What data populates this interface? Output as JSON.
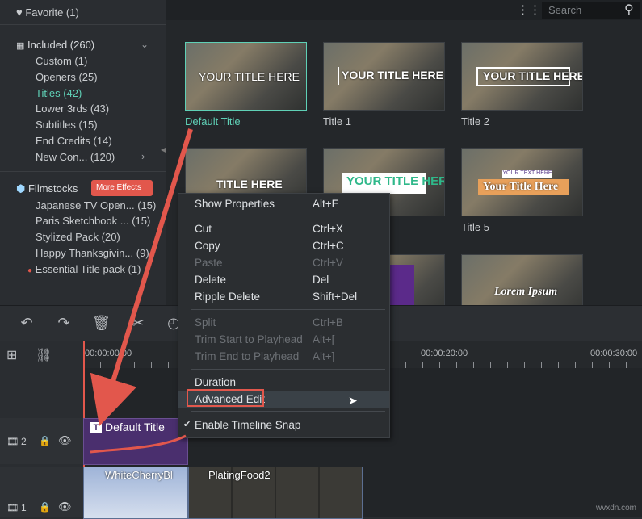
{
  "sidebar": {
    "favorite": "Favorite (1)",
    "included": "Included (260)",
    "included_items": [
      "Custom (1)",
      "Openers (25)",
      "Titles (42)",
      "Lower 3rds (43)",
      "Subtitles (15)",
      "End Credits (14)",
      "New Con... (120)"
    ],
    "filmstocks": "Filmstocks",
    "more_effects": "More Effects",
    "filmstock_items": [
      "Japanese TV Open... (15)",
      "Paris Sketchbook ... (15)",
      "Stylized Pack (20)",
      "Happy Thanksgivin... (9)",
      "Essential Title pack (1)"
    ]
  },
  "search": {
    "placeholder": "Search"
  },
  "gallery": {
    "items": [
      {
        "caption": "Default Title",
        "text": "YOUR TITLE HERE"
      },
      {
        "caption": "Title 1",
        "text": "YOUR TITLE HERE"
      },
      {
        "caption": "Title 2",
        "text": "YOUR TITLE HERE"
      },
      {
        "caption": "",
        "text": "TITLE HERE"
      },
      {
        "caption": "",
        "text": "YOUR TITLE HERE"
      },
      {
        "caption": "Title 5",
        "text": "Your Title Here",
        "sub": "YOUR TEXT HERE"
      },
      {
        "caption": "",
        "text": ""
      },
      {
        "caption": "",
        "text": ""
      },
      {
        "caption": "",
        "text": "Lorem Ipsum"
      }
    ]
  },
  "timeline": {
    "ruler": [
      "00:00:00:00",
      "00:00:20:00",
      "00:00:30:00"
    ],
    "tracks": [
      {
        "label": "2",
        "clip": "Default Title"
      },
      {
        "label": "1",
        "clips": [
          "WhiteCherryBl",
          "PlatingFood2"
        ]
      }
    ]
  },
  "context_menu": {
    "items": [
      {
        "label": "Show Properties",
        "shortcut": "Alt+E"
      },
      {
        "label": "Cut",
        "shortcut": "Ctrl+X"
      },
      {
        "label": "Copy",
        "shortcut": "Ctrl+C"
      },
      {
        "label": "Paste",
        "shortcut": "Ctrl+V"
      },
      {
        "label": "Delete",
        "shortcut": "Del"
      },
      {
        "label": "Ripple Delete",
        "shortcut": "Shift+Del"
      },
      {
        "label": "Split",
        "shortcut": "Ctrl+B"
      },
      {
        "label": "Trim Start to Playhead",
        "shortcut": "Alt+["
      },
      {
        "label": "Trim End to Playhead",
        "shortcut": "Alt+]"
      },
      {
        "label": "Duration",
        "shortcut": ""
      },
      {
        "label": "Advanced Edit",
        "shortcut": ""
      },
      {
        "label": "Enable Timeline Snap",
        "shortcut": ""
      }
    ]
  },
  "watermark": "wvxdn.com",
  "colors": {
    "accent": "#5fd0b6",
    "highlight_red": "#e2574c",
    "title_track": "#4a2f6e"
  }
}
